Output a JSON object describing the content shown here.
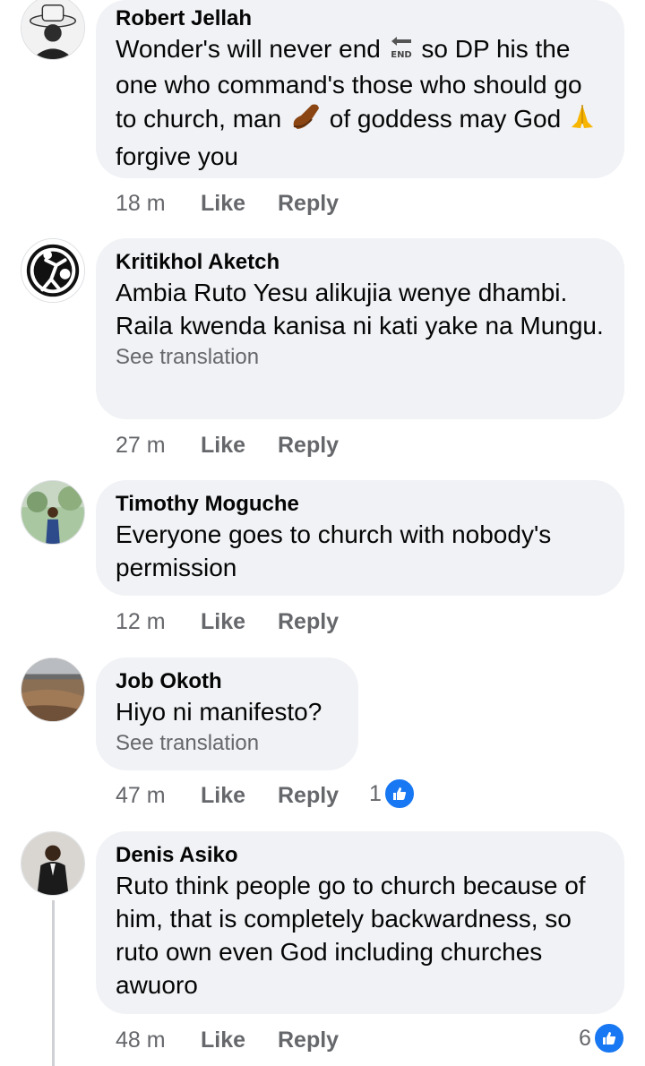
{
  "comments": [
    {
      "author": "Robert Jellah",
      "text_1": "Wonder's will never end ",
      "text_2": " so DP his the one who command's those who should go to church, man ",
      "text_3": " of goddess may God ",
      "text_4": " forgive you",
      "emoji": [
        "end-arrow-emoji",
        "shoe-emoji",
        "praying-hands-emoji"
      ],
      "time": "18 m",
      "like": "Like",
      "reply": "Reply"
    },
    {
      "author": "Kritikhol Aketch",
      "text": "Ambia Ruto Yesu alikujia wenye dhambi. Raila kwenda kanisa ni kati yake na Mungu.",
      "see_translation": "See translation",
      "time": "27 m",
      "like": "Like",
      "reply": "Reply"
    },
    {
      "author": "Timothy Moguche",
      "text": "Everyone goes to church with nobody's permission",
      "time": "12 m",
      "like": "Like",
      "reply": "Reply"
    },
    {
      "author": "Job Okoth",
      "text": "Hiyo ni manifesto?",
      "see_translation": "See translation",
      "time": "47 m",
      "like": "Like",
      "reply": "Reply",
      "reactions": "1",
      "reaction_icon": "like-thumb-icon"
    },
    {
      "author": "Denis Asiko",
      "text": "Ruto think people go to church because of him, that is completely backwardness, so ruto own even God including churches awuoro",
      "time": "48 m",
      "like": "Like",
      "reply": "Reply",
      "reactions": "6",
      "reaction_icon": "like-thumb-icon"
    }
  ],
  "colors": {
    "bubble": "#f0f2f5",
    "meta_text": "#65676b",
    "like_blue": "#1877f2"
  }
}
